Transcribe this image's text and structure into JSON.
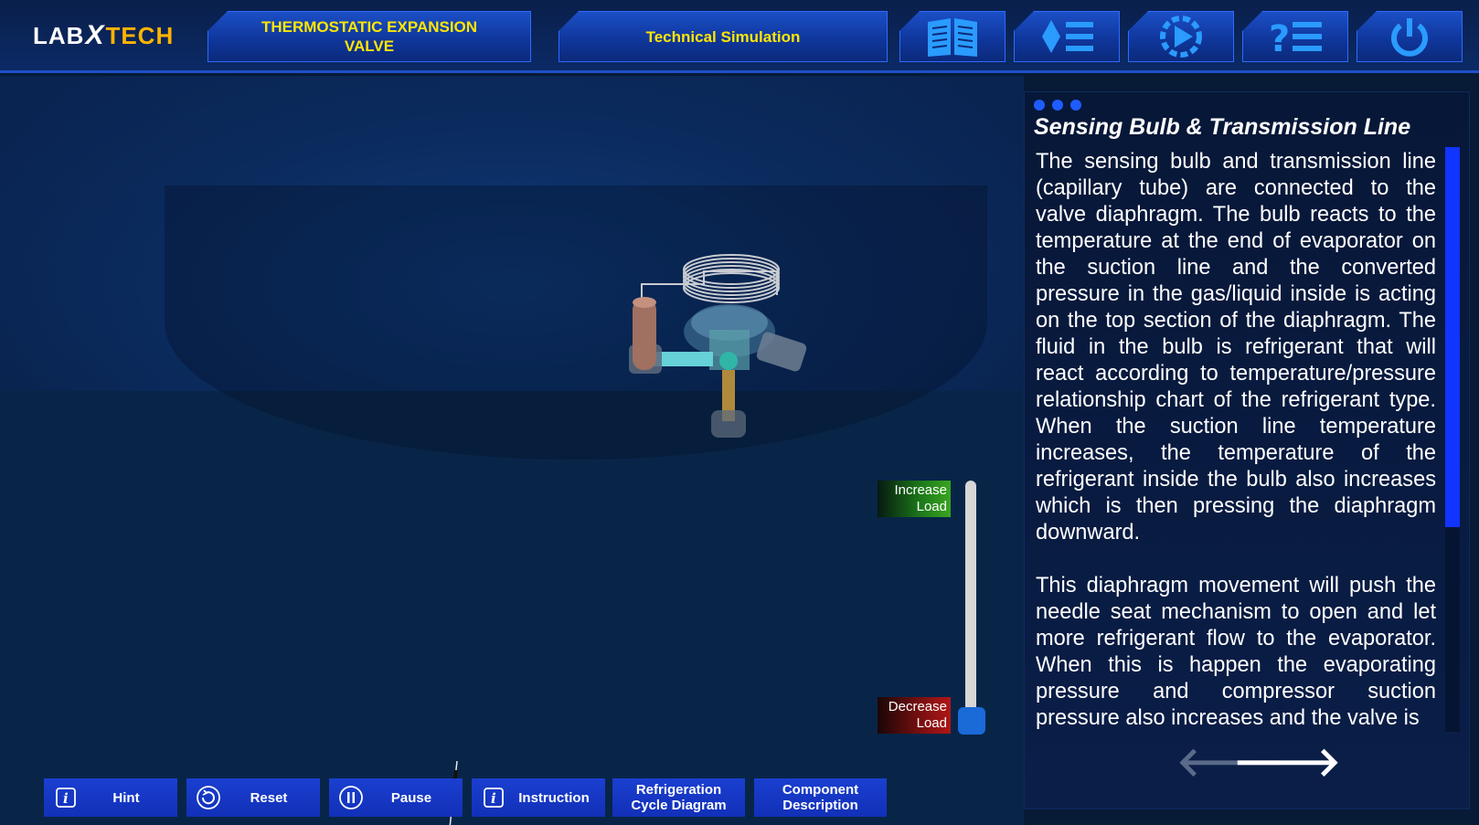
{
  "header": {
    "logo": {
      "lab": "LAB",
      "x": "X",
      "tech": "TECH"
    },
    "title_line1": "THERMOSTATIC EXPANSION",
    "title_line2": "VALVE",
    "simulation": "Technical Simulation",
    "icon_buttons": [
      {
        "name": "manual-book-icon"
      },
      {
        "name": "menu-list-icon"
      },
      {
        "name": "play-settings-icon"
      },
      {
        "name": "help-list-icon"
      },
      {
        "name": "power-icon"
      }
    ]
  },
  "panel": {
    "title": "Sensing Bulb & Transmission Line",
    "paragraph1": "The sensing bulb and transmission line (capillary tube) are connected to the valve diaphragm. The bulb reacts to the temperature at the end of evaporator on the suction line and the converted pressure in the gas/liquid inside is acting on the top section of the diaphragm. The fluid in the bulb is refrigerant that will react according to temperature/pressure relationship chart of the refrigerant type. When the suction line temperature increases, the temperature of the refrigerant inside the bulb also increases which is then pressing the diaphragm downward.",
    "paragraph2": "This diaphragm movement will push the needle seat mechanism to open and let more refrigerant flow to the evaporator. When this is happen the evaporating pressure and compressor suction pressure also increases and the valve is",
    "prev_arrow": "🡐",
    "next_arrow": "🡒"
  },
  "load": {
    "increase_line1": "Increase",
    "increase_line2": "Load",
    "decrease_line1": "Decrease",
    "decrease_line2": "Load",
    "level": 0.0
  },
  "toolbar": {
    "hint": "Hint",
    "reset": "Reset",
    "pause": "Pause",
    "instruction": "Instruction",
    "refrig_line1": "Refrigeration",
    "refrig_line2": "Cycle Diagram",
    "component_line1": "Component",
    "component_line2": "Description"
  },
  "colors": {
    "accent_yellow": "#ffe600",
    "button_blue": "#1230b8",
    "increase_green": "#3aa520",
    "decrease_red": "#b01616"
  }
}
